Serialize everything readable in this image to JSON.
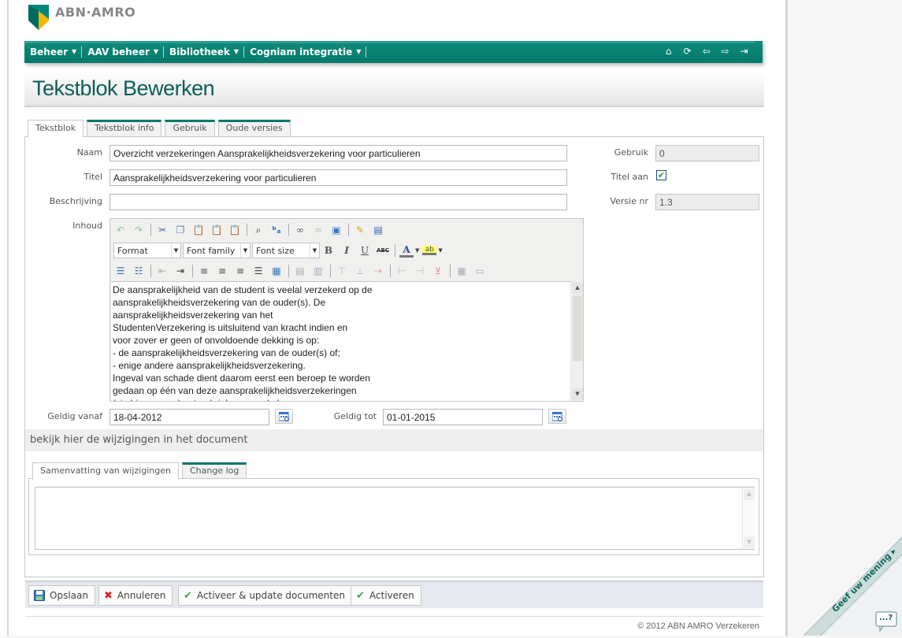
{
  "brand": {
    "name": "ABN·AMRO",
    "colors": {
      "primary": "#00796b",
      "accent": "#f2b705",
      "title": "#0b5f5a"
    }
  },
  "nav": {
    "items": [
      {
        "label": "Beheer",
        "icon": "chevron-down-icon"
      },
      {
        "label": "AAV beheer",
        "icon": "chevron-down-icon"
      },
      {
        "label": "Bibliotheek",
        "icon": "chevron-down-icon"
      },
      {
        "label": "Cogniam integratie",
        "icon": "chevron-down-icon"
      }
    ],
    "icons": [
      "home-icon",
      "refresh-icon",
      "back-icon",
      "forward-icon",
      "logout-icon"
    ]
  },
  "page": {
    "title": "Tekstblok Bewerken"
  },
  "tabs": [
    {
      "label": "Tekstblok",
      "active": true
    },
    {
      "label": "Tekstblok info",
      "active": false
    },
    {
      "label": "Gebruik",
      "active": false
    },
    {
      "label": "Oude versies",
      "active": false
    }
  ],
  "form": {
    "naam": {
      "label": "Naam",
      "value": "Overzicht verzekeringen Aansprakelijkheidsverzekering voor particulieren"
    },
    "titel": {
      "label": "Titel",
      "value": "Aansprakelijkheidsverzekering voor particulieren"
    },
    "beschrijving": {
      "label": "Beschrijving",
      "value": ""
    },
    "inhoud": {
      "label": "Inhoud"
    },
    "gebruik": {
      "label": "Gebruik",
      "value": "0"
    },
    "titel_aan": {
      "label": "Titel aan",
      "checked": true,
      "mark": "✔"
    },
    "versie": {
      "label": "Versie nr",
      "value": "1.3"
    },
    "geldig_vanaf": {
      "label": "Geldig vanaf",
      "value": "18-04-2012"
    },
    "geldig_tot": {
      "label": "Geldig tot",
      "value": "01-01-2015"
    }
  },
  "editor": {
    "format_placeholder": "Format",
    "font_family_placeholder": "Font family",
    "font_size_placeholder": "Font size",
    "toolbar_labels": {
      "bold": "B",
      "italic": "I",
      "underline": "U",
      "strike": "ABC",
      "forecolor": "A",
      "backcolor": "ab"
    },
    "content": [
      "De aansprakelijkheid van de student is veelal verzekerd op de",
      "aansprakelijkheidsverzekering van de ouder(s). De",
      "aansprakelijkheidsverzekering van het",
      "StudentenVerzekering is uitsluitend van kracht indien en",
      "voor zover er geen of onvoldoende dekking is op:",
      "- de aansprakelijkheidsverzekering van de ouder(s) of;",
      "- enige andere aansprakelijkheidsverzekering.",
      "Ingeval van schade dient daarom eerst een beroep te worden",
      "gedaan op één van deze aansprakelijkheidsverzekeringen",
      "(zie hiervoor ook art. rubriek aansprakel"
    ]
  },
  "changes": {
    "heading": "bekijk hier de wijzigingen in het document",
    "tabs": [
      {
        "label": "Samenvatting van wijzigingen",
        "active": true
      },
      {
        "label": "Change log",
        "active": false
      }
    ],
    "summary_value": ""
  },
  "buttons": [
    {
      "label": "Opslaan",
      "icon": "save-icon"
    },
    {
      "label": "Annuleren",
      "icon": "cancel-icon"
    },
    {
      "label": "Activeer & update documenten",
      "icon": "check-icon"
    },
    {
      "label": "Activeren",
      "icon": "check-icon"
    }
  ],
  "footer": {
    "copyright": "© 2012 ABN AMRO Verzekeren"
  },
  "feedback": {
    "label": "Geef uw mening ▸",
    "bubble": "...?"
  }
}
